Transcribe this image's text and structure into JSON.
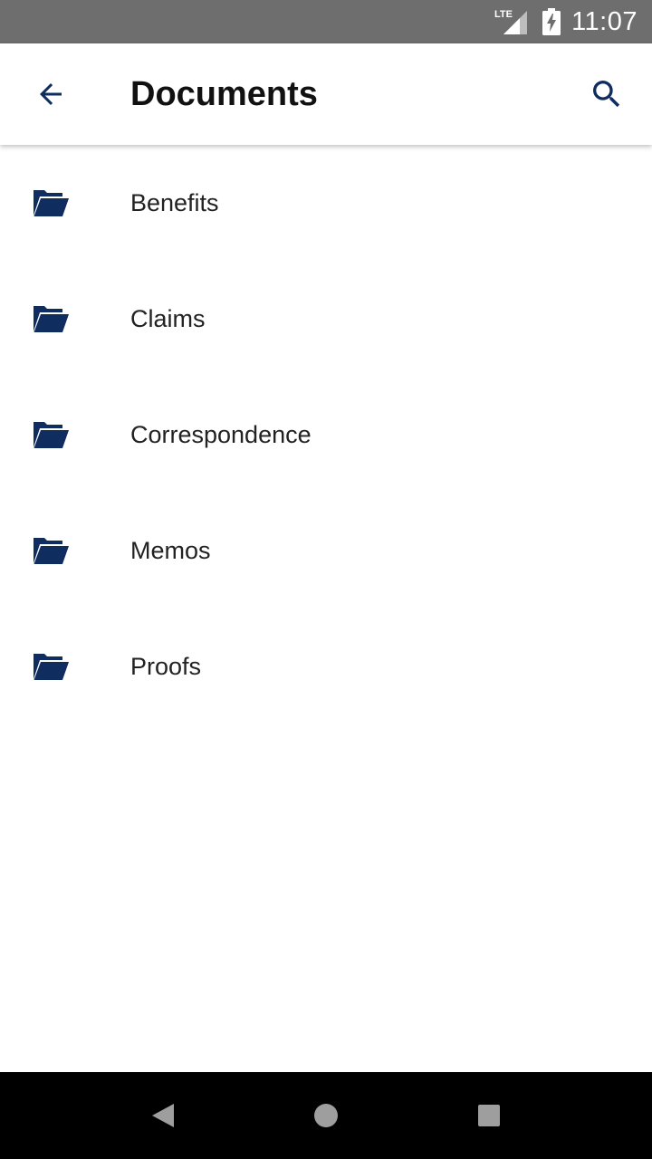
{
  "status_bar": {
    "network": "LTE",
    "time": "11:07"
  },
  "app_bar": {
    "title": "Documents",
    "back_icon": "arrow-back-icon",
    "search_icon": "search-icon"
  },
  "folders": [
    {
      "label": "Benefits",
      "icon": "folder-open-icon"
    },
    {
      "label": "Claims",
      "icon": "folder-open-icon"
    },
    {
      "label": "Correspondence",
      "icon": "folder-open-icon"
    },
    {
      "label": "Memos",
      "icon": "folder-open-icon"
    },
    {
      "label": "Proofs",
      "icon": "folder-open-icon"
    }
  ],
  "nav_bar": {
    "buttons": [
      "back-triangle-icon",
      "home-circle-icon",
      "recents-square-icon"
    ]
  },
  "colors": {
    "accent": "#0f2d5f",
    "status_bar": "#6e6e6e",
    "nav_bar": "#000000",
    "nav_icons": "#9e9e9e"
  }
}
